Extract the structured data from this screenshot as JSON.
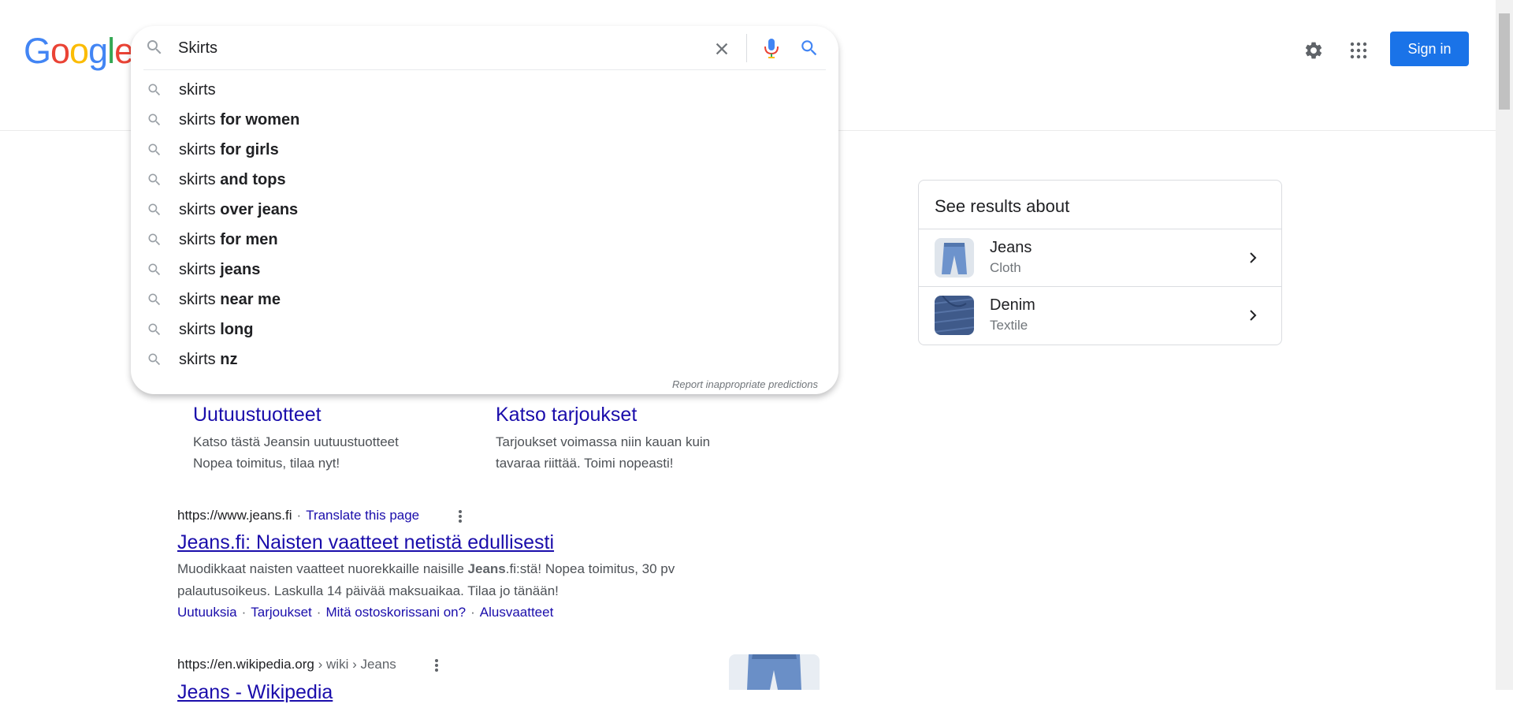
{
  "header": {
    "logo_letters": [
      {
        "ch": "G",
        "color": "#4285f4"
      },
      {
        "ch": "o",
        "color": "#ea4335"
      },
      {
        "ch": "o",
        "color": "#fbbc05"
      },
      {
        "ch": "g",
        "color": "#4285f4"
      },
      {
        "ch": "l",
        "color": "#34a853"
      },
      {
        "ch": "e",
        "color": "#ea4335"
      }
    ],
    "sign_in_label": "Sign in",
    "settings_icon": "gear-icon",
    "apps_icon": "apps-grid-icon"
  },
  "search": {
    "value": "Skirts",
    "suggestions": [
      {
        "base": "skirts",
        "bold": ""
      },
      {
        "base": "skirts",
        "bold": "for women"
      },
      {
        "base": "skirts",
        "bold": "for girls"
      },
      {
        "base": "skirts",
        "bold": "and tops"
      },
      {
        "base": "skirts",
        "bold": "over jeans"
      },
      {
        "base": "skirts",
        "bold": "for men"
      },
      {
        "base": "skirts",
        "bold": "jeans"
      },
      {
        "base": "skirts",
        "bold": "near me"
      },
      {
        "base": "skirts",
        "bold": "long"
      },
      {
        "base": "skirts",
        "bold": "nz"
      }
    ],
    "report_label": "Report inappropriate predictions"
  },
  "ad_sitelinks": [
    {
      "title": "Uutuustuotteet",
      "line1": "Katso tästä Jeansin uutuustuotteet",
      "line2": "Nopea toimitus, tilaa nyt!"
    },
    {
      "title": "Katso tarjoukset",
      "line1": "Tarjoukset voimassa niin kauan kuin",
      "line2": "tavaraa riittää. Toimi nopeasti!"
    }
  ],
  "results": [
    {
      "url": "https://www.jeans.fi",
      "translate": "Translate this page",
      "title": "Jeans.fi: Naisten vaatteet netistä edullisesti",
      "snippet_pre": "Muodikkaat naisten vaatteet nuorekkaille naisille ",
      "snippet_bold": "Jeans",
      "snippet_post": ".fi:stä! Nopea toimitus, 30 pv palautusoikeus. Laskulla 14 päivää maksuaikaa. Tilaa jo tänään!",
      "links": [
        "Uutuuksia",
        "Tarjoukset",
        "Mitä ostoskorissani on?",
        "Alusvaatteet"
      ]
    },
    {
      "url": "https://en.wikipedia.org",
      "crumbs": "› wiki › Jeans",
      "title": "Jeans - Wikipedia"
    }
  ],
  "knowledge_panel": {
    "title": "See results about",
    "items": [
      {
        "name": "Jeans",
        "sub": "Cloth"
      },
      {
        "name": "Denim",
        "sub": "Textile"
      }
    ]
  },
  "colors": {
    "link": "#1a0dab",
    "accent": "#1a73e8",
    "text": "#202124",
    "muted": "#70757a"
  }
}
